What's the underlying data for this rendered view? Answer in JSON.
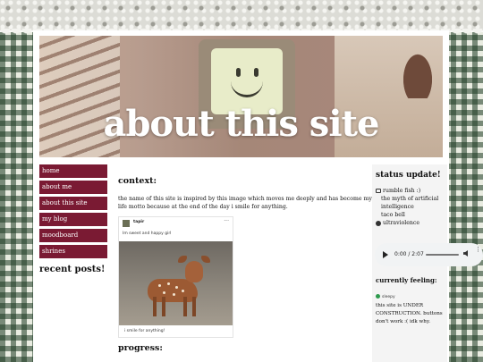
{
  "banner": {
    "title": "about this site"
  },
  "nav": {
    "items": [
      {
        "label": "home"
      },
      {
        "label": "about me"
      },
      {
        "label": "about this site"
      },
      {
        "label": "my blog"
      },
      {
        "label": "moodboard"
      },
      {
        "label": "shrines"
      }
    ]
  },
  "left": {
    "recent_heading": "recent posts!"
  },
  "main": {
    "context_heading": "context:",
    "context_text": "the name of this site is inspired by this image which moves me deeply and has become my life motto because at the end of the day i smile for anything.",
    "post": {
      "username": "tapir",
      "menu": "···",
      "text": "Im sweet and happy girl",
      "caption": "i smile for anything!"
    },
    "progress_heading": "progress:"
  },
  "right": {
    "status_heading": "status update!",
    "lines": [
      {
        "icon": "tv-icon",
        "text": "rumble fish :)"
      },
      {
        "icon": "",
        "text": "the myth of artificial intelligence"
      },
      {
        "icon": "",
        "text": "taco bell"
      },
      {
        "icon": "vinyl-icon",
        "text": "ultraviolence"
      }
    ],
    "audio": {
      "time": "0:00 / 2:07",
      "progress": 0
    },
    "feeling_heading": "currently feeling:",
    "feeling_badge": "sleepy",
    "feeling_text": "this site is UNDER CONSTRUCTION. buttons don't work :( idk why."
  }
}
